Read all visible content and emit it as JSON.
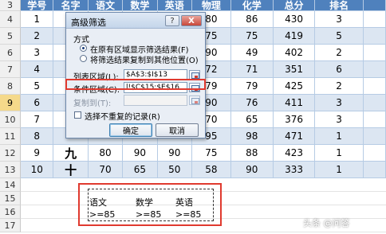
{
  "sheet": {
    "header_row": {
      "row": "3",
      "cells": [
        "学号",
        "名字",
        "语文",
        "数学",
        "英语",
        "物理",
        "化学",
        "总分",
        "排名"
      ]
    },
    "rows": [
      {
        "row": "4",
        "cells": [
          "1",
          "",
          "",
          "",
          "",
          "80",
          "86",
          "430",
          "3"
        ]
      },
      {
        "row": "5",
        "cells": [
          "2",
          "",
          "",
          "",
          "",
          "75",
          "75",
          "419",
          "5"
        ]
      },
      {
        "row": "6",
        "cells": [
          "3",
          "",
          "",
          "",
          "",
          "90",
          "49",
          "402",
          "2"
        ]
      },
      {
        "row": "7",
        "cells": [
          "4",
          "",
          "",
          "",
          "",
          "72",
          "71",
          "351",
          "6"
        ]
      },
      {
        "row": "8",
        "cells": [
          "5",
          "",
          "",
          "",
          "",
          "79",
          "79",
          "425",
          "2"
        ]
      },
      {
        "row": "9",
        "cells": [
          "6",
          "",
          "",
          "",
          "",
          "90",
          "76",
          "411",
          "3"
        ]
      },
      {
        "row": "10",
        "cells": [
          "7",
          "",
          "",
          "",
          "",
          "70",
          "65",
          "376",
          "3"
        ]
      },
      {
        "row": "11",
        "cells": [
          "8",
          "",
          "",
          "",
          "",
          "95",
          "98",
          "471",
          "1"
        ]
      },
      {
        "row": "12",
        "cells": [
          "9",
          "九",
          "80",
          "90",
          "90",
          "75",
          "88",
          "423",
          "1"
        ]
      },
      {
        "row": "13",
        "cells": [
          "10",
          "十",
          "70",
          "65",
          "50",
          "58",
          "90",
          "333",
          "1"
        ]
      }
    ],
    "blank_rows": [
      "14",
      "15",
      "16",
      "17"
    ],
    "criteria": {
      "headers": [
        "语文",
        "数学",
        "英语"
      ],
      "values": [
        ">=85",
        ">=85",
        ">=85"
      ]
    }
  },
  "dialog": {
    "title": "高级筛选",
    "help": "?",
    "close": "X",
    "section_label": "方式",
    "radio_1": "在原有区域显示筛选结果(F)",
    "radio_2": "将筛选结果复制到其他位置(O)",
    "list_range_label": "列表区域(L):",
    "list_range_value": "$A$3:$I$13",
    "criteria_range_label": "条件区域(C):",
    "criteria_range_value": "l!$C$15:$E$16",
    "copy_to_label": "复制到(T):",
    "copy_to_value": "",
    "unique_label": "选择不重复的记录(R)",
    "ok": "确定",
    "cancel": "取消"
  },
  "watermark": "头条 @问答"
}
